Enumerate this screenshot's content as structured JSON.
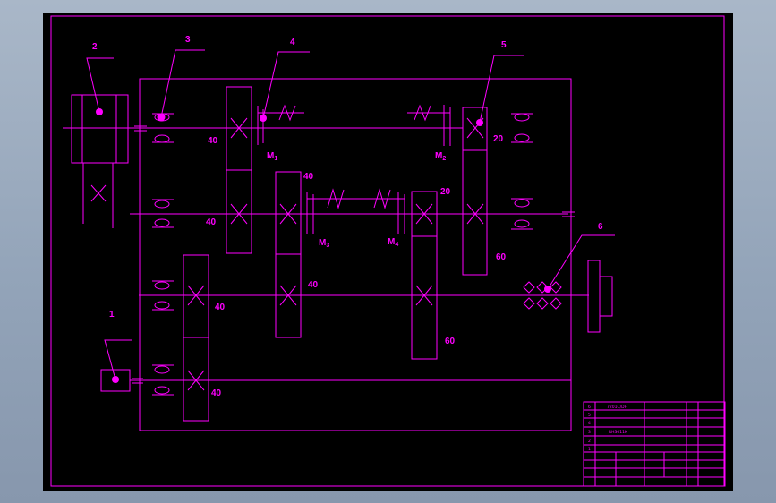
{
  "colors": {
    "line": "#ff00ff",
    "background": "#000000",
    "desktop": "#9aaabd"
  },
  "callouts": [
    "1",
    "2",
    "3",
    "4",
    "5",
    "6"
  ],
  "teeth": {
    "shaft1_gearA": "40",
    "shaft2_gearA": "40",
    "shaft2_gearB": "40",
    "shaft3_gearA": "40",
    "shaft3_gearB": "40",
    "shaft4_gearA": "40",
    "shaft1_gearB": "20",
    "shaft2_gearC": "20",
    "shaft2_gearD": "60",
    "shaft3_gearC": "60"
  },
  "clutches": {
    "m1": {
      "letter": "M",
      "sub": "1"
    },
    "m2": {
      "letter": "M",
      "sub": "2"
    },
    "m3": {
      "letter": "M",
      "sub": "3"
    },
    "m4": {
      "letter": "M",
      "sub": "4"
    }
  },
  "title_block": {
    "row_numbers": [
      "6",
      "5",
      "4",
      "3",
      "2",
      "1"
    ],
    "rows": [
      "7201C/DF",
      "",
      "RH3011K",
      "",
      "",
      ""
    ]
  }
}
